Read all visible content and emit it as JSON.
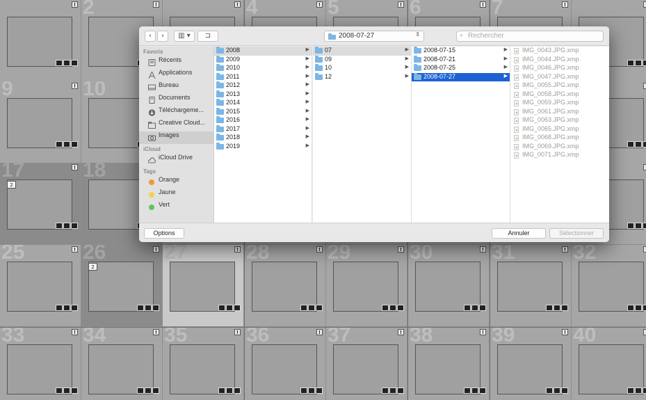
{
  "grid_numbers": [
    "2",
    "4",
    "5",
    "6",
    "7",
    "9",
    "10",
    "17",
    "18",
    "25",
    "26",
    "27",
    "28",
    "29",
    "30",
    "31",
    "32",
    "33",
    "34",
    "35",
    "36",
    "37",
    "38",
    "39",
    "40"
  ],
  "stack_badges": [
    "2",
    "2"
  ],
  "flag_glyph": "!",
  "toolbar": {
    "back_glyph": "‹",
    "forward_glyph": "›",
    "view_glyph": "▥ ▾",
    "newfolder_glyph": "⊐",
    "path_value": "2008-07-27",
    "path_arrows": "⇕",
    "search_placeholder": "Rechercher",
    "search_glyph": "⌕"
  },
  "sidebar": {
    "favoris_header": "Favoris",
    "favoris": [
      {
        "label": "Récents",
        "icon": "clock-icon"
      },
      {
        "label": "Applications",
        "icon": "applications-icon"
      },
      {
        "label": "Bureau",
        "icon": "desktop-icon"
      },
      {
        "label": "Documents",
        "icon": "documents-icon"
      },
      {
        "label": "Téléchargeme...",
        "icon": "download-icon"
      },
      {
        "label": "Creative Cloud...",
        "icon": "folder-icon"
      },
      {
        "label": "Images",
        "icon": "camera-icon"
      }
    ],
    "icloud_header": "iCloud",
    "icloud": [
      {
        "label": "iCloud Drive",
        "icon": "cloud-icon"
      }
    ],
    "tags_header": "Tags",
    "tags": [
      {
        "label": "Orange",
        "color": "#f0963b"
      },
      {
        "label": "Jaune",
        "color": "#f5d04a"
      },
      {
        "label": "Vert",
        "color": "#5ec65e"
      }
    ]
  },
  "columns": {
    "years": [
      "2008",
      "2009",
      "2010",
      "2011",
      "2012",
      "2013",
      "2014",
      "2015",
      "2016",
      "2017",
      "2018",
      "2019"
    ],
    "months": [
      "07",
      "09",
      "10",
      "12"
    ],
    "days": [
      "2008-07-15",
      "2008-07-21",
      "2008-07-25",
      "2008-07-27"
    ],
    "files": [
      "IMG_0043.JPG.xmp",
      "IMG_0044.JPG.xmp",
      "IMG_0046.JPG.xmp",
      "IMG_0047.JPG.xmp",
      "IMG_0055.JPG.xmp",
      "IMG_0058.JPG.xmp",
      "IMG_0059.JPG.xmp",
      "IMG_0061.JPG.xmp",
      "IMG_0063.JPG.xmp",
      "IMG_0065.JPG.xmp",
      "IMG_0068.JPG.xmp",
      "IMG_0069.JPG.xmp",
      "IMG_0071.JPG.xmp"
    ],
    "arrow_glyph": "▶"
  },
  "buttons": {
    "options": "Options",
    "cancel": "Annuler",
    "select": "Sélectionner"
  },
  "colors": {
    "selection": "#1c62d6",
    "folder": "#7cb6e6"
  }
}
